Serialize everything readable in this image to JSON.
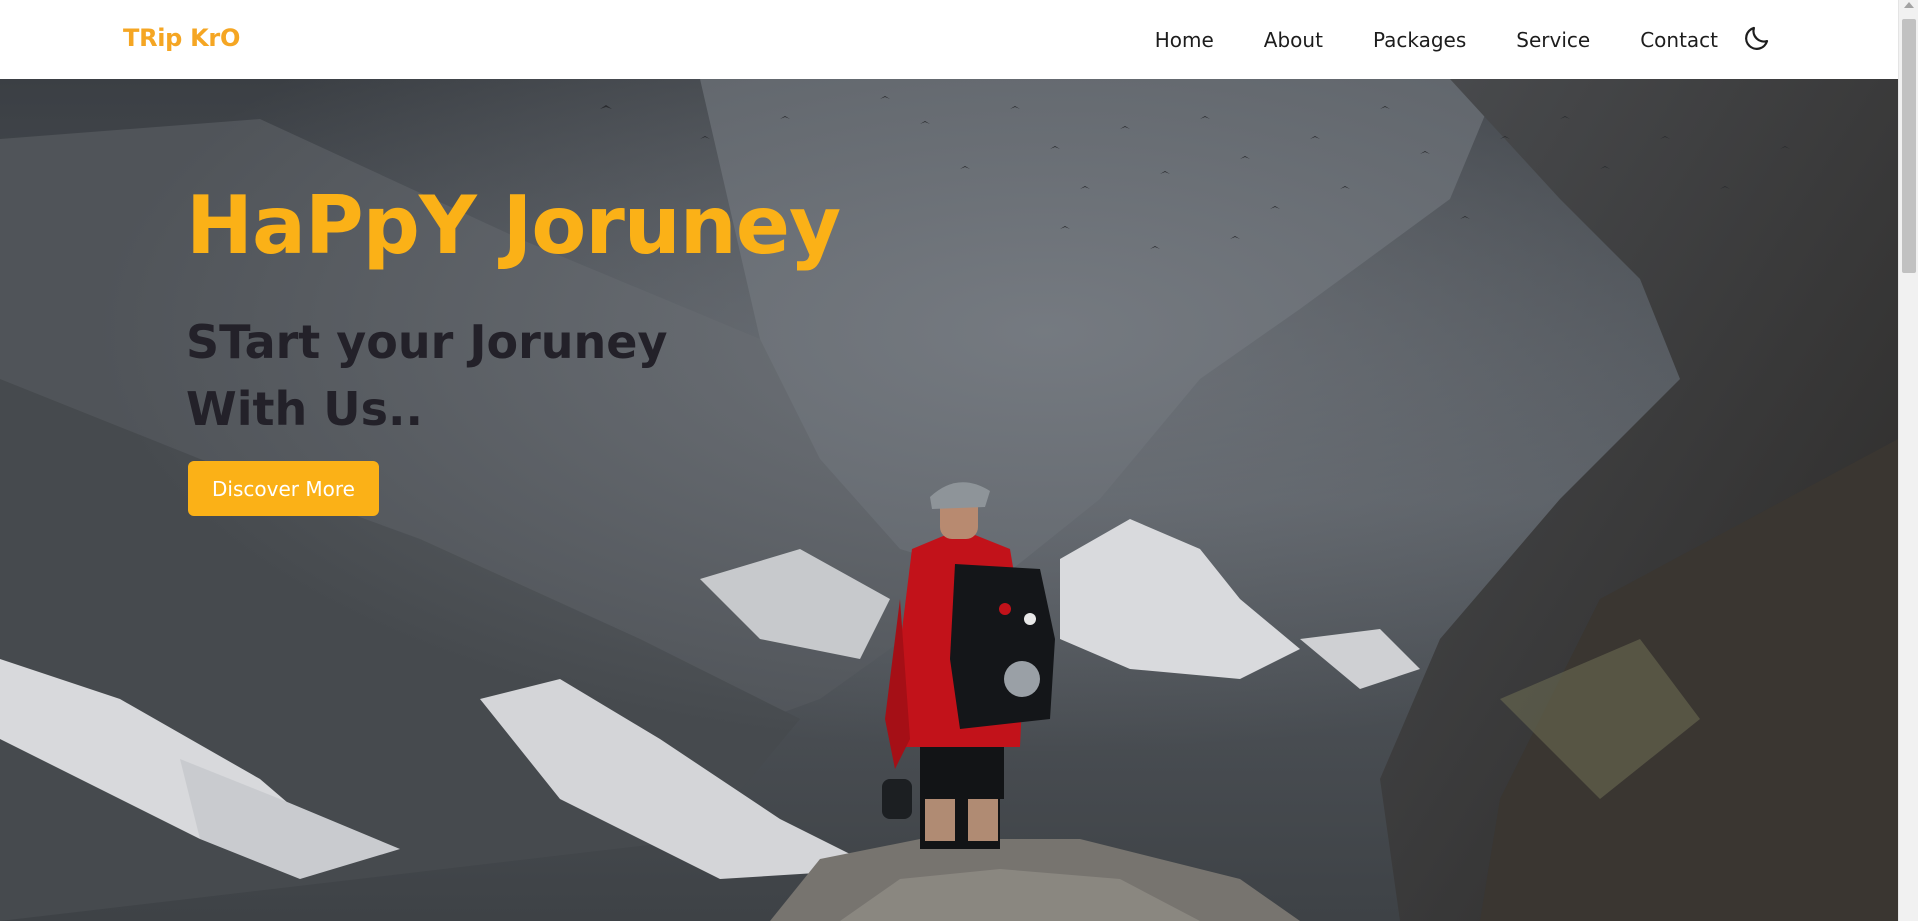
{
  "brand": {
    "name": "TRip KrO"
  },
  "nav": {
    "items": [
      {
        "label": "Home"
      },
      {
        "label": "About"
      },
      {
        "label": "Packages"
      },
      {
        "label": "Service"
      },
      {
        "label": "Contact"
      }
    ],
    "theme_toggle_icon": "moon-icon"
  },
  "hero": {
    "title": "HaPpY Joruney",
    "subtitle_line1": "STart your Joruney",
    "subtitle_line2": "With Us..",
    "cta_label": "Discover More",
    "background": "mountain-hiker-photo"
  },
  "colors": {
    "accent": "#fbb117",
    "brand": "#f5a623",
    "subtitle": "#232129",
    "nav_text": "#1d1d1d"
  }
}
